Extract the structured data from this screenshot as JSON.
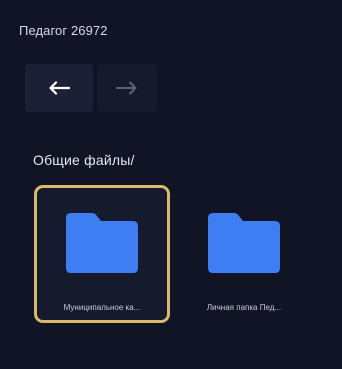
{
  "header": {
    "user_name": "Педагог 26972"
  },
  "navigation": {
    "back_icon": "arrow-left-icon",
    "forward_icon": "arrow-right-icon"
  },
  "breadcrumb": {
    "path": "Общие файлы/"
  },
  "files": [
    {
      "label": "Муниципальное ка...",
      "icon": "folder-icon",
      "selected": true
    },
    {
      "label": "Личная папка Пед...",
      "icon": "folder-icon",
      "selected": false
    }
  ],
  "colors": {
    "background": "#111425",
    "folder": "#3f7ef2",
    "selection_border": "#d9b96e"
  }
}
